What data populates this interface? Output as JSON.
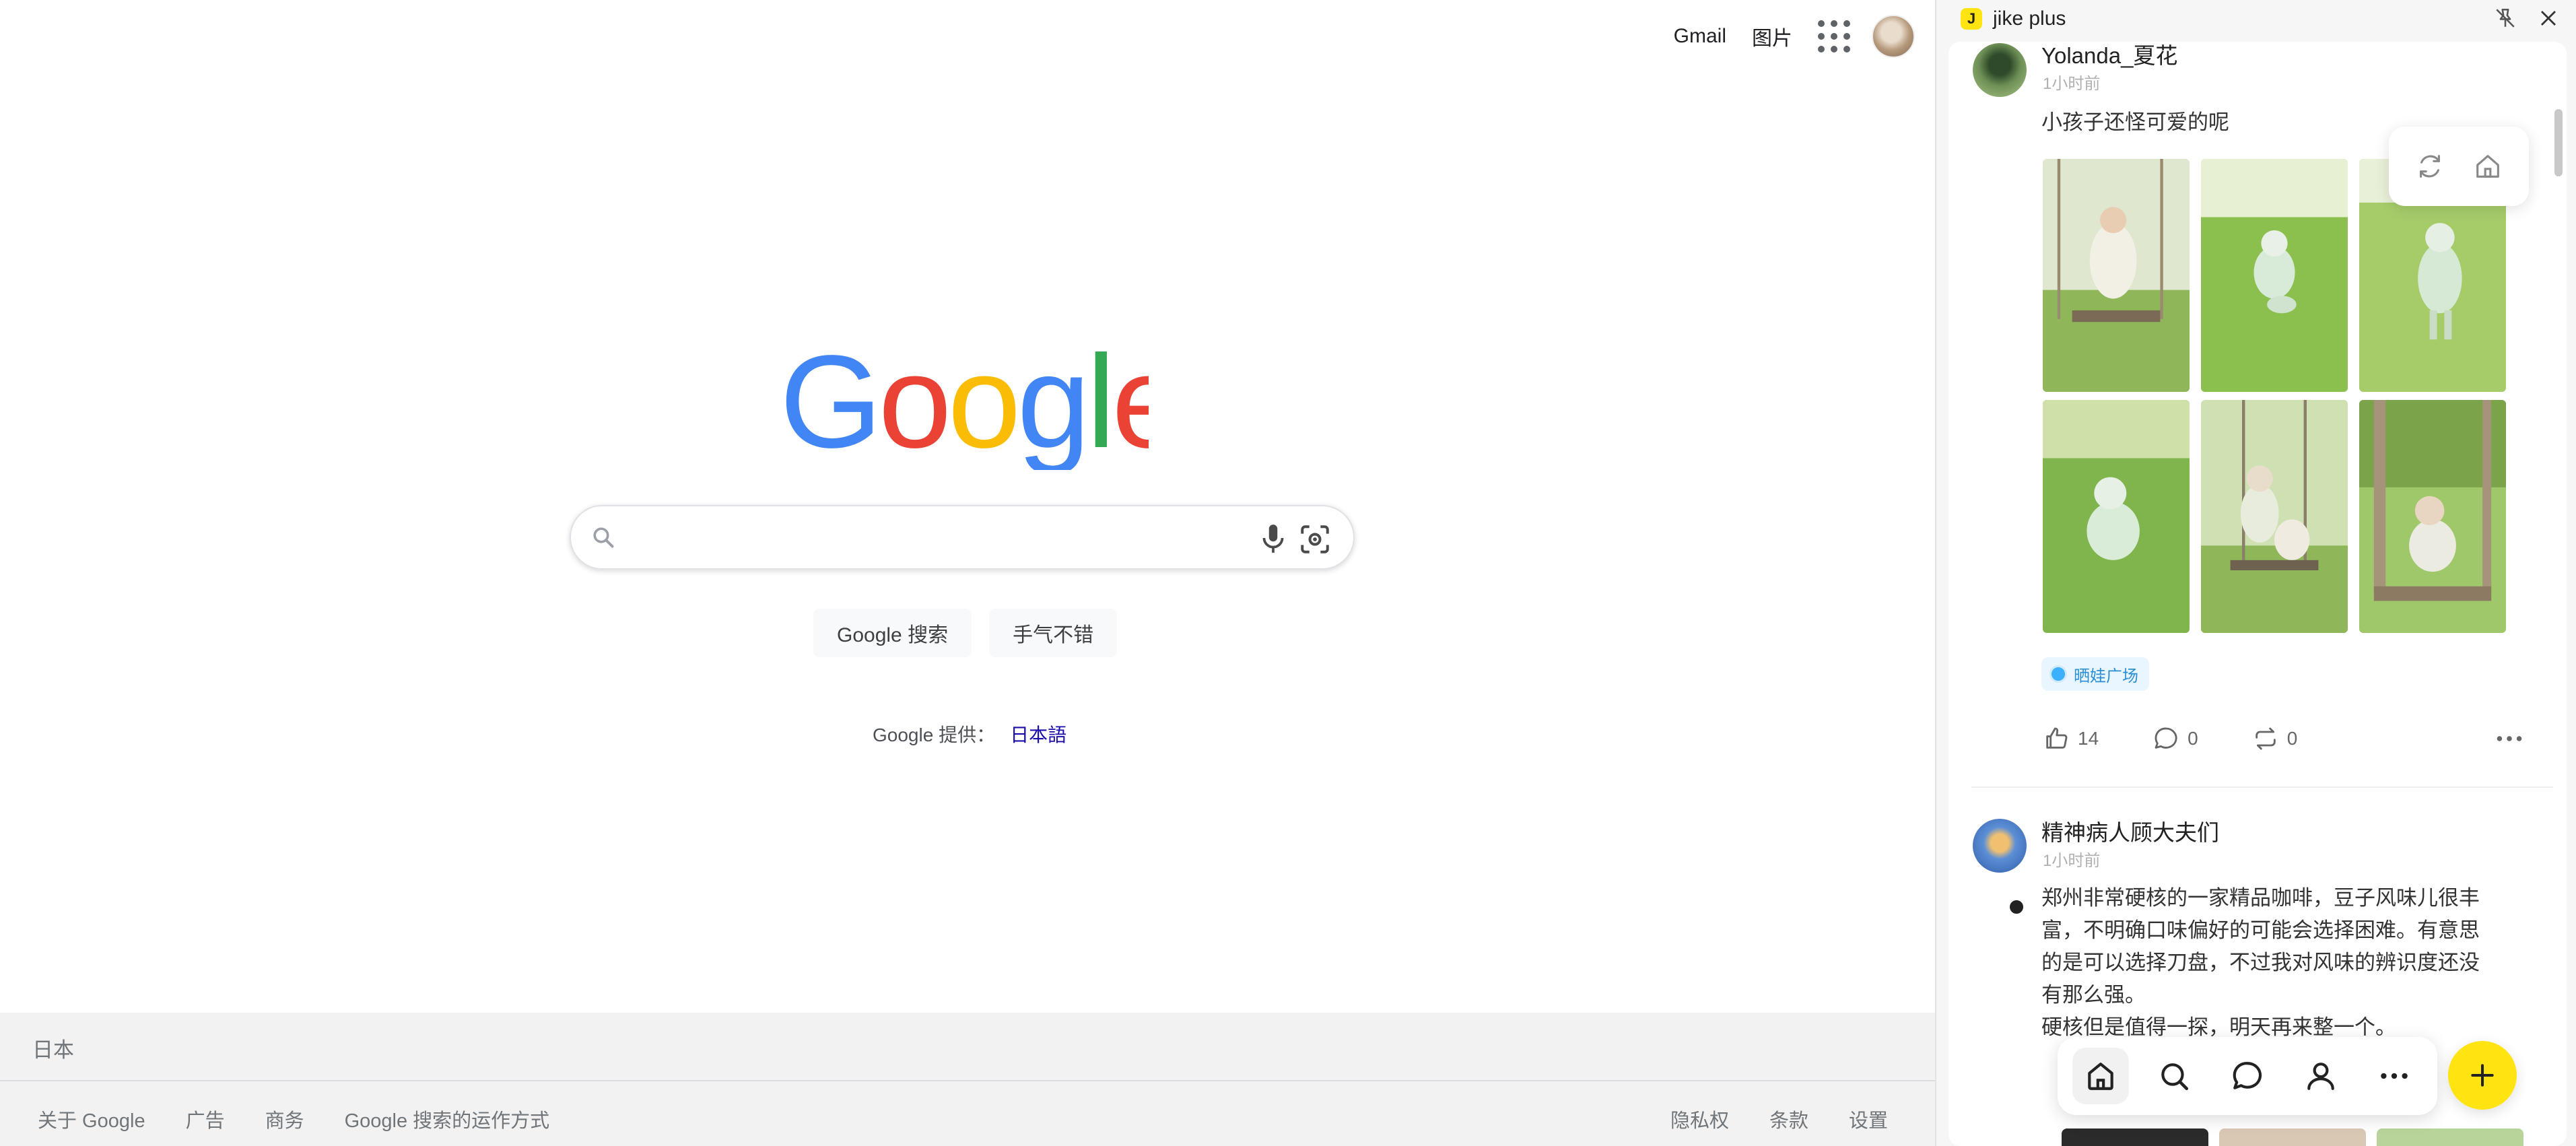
{
  "google": {
    "top_links": {
      "gmail": "Gmail",
      "images": "图片"
    },
    "search": {
      "placeholder": "",
      "value": ""
    },
    "buttons": {
      "search": "Google 搜索",
      "lucky": "手气不错"
    },
    "offered_in": {
      "label": "Google 提供：",
      "language": "日本語"
    },
    "footer": {
      "country": "日本",
      "left_links": [
        "关于 Google",
        "广告",
        "商务",
        "Google 搜索的运作方式"
      ],
      "right_links": [
        "隐私权",
        "条款",
        "设置"
      ]
    },
    "colors": {
      "blue": "#4285F4",
      "red": "#EA4335",
      "yellow": "#FBBC05",
      "green": "#34A853"
    }
  },
  "jike": {
    "window_title": "jike plus",
    "logo_glyph": "J",
    "accent": "#FFE411",
    "posts": [
      {
        "author": "Yolanda_夏花",
        "time": "1小时前",
        "text": "小孩子还怪可爱的呢",
        "photos_count": 6,
        "topic": "晒娃广场",
        "likes": "14",
        "comments": "0",
        "reposts": "0"
      },
      {
        "author": "精神病人顾大夫们",
        "time": "1小时前",
        "text_lines": [
          "郑州非常硬核的一家精品咖啡，豆子风味儿很丰",
          "富，不明确口味偏好的可能会选择困难。有意思",
          "的是可以选择刀盘，不过我对风味的辨识度还没",
          "有那么强。",
          "硬核但是值得一探，明天再来整一个。"
        ]
      }
    ],
    "float_tools": [
      "refresh-icon",
      "home-icon"
    ],
    "tabbar": [
      "home-icon",
      "search-icon",
      "message-icon",
      "profile-icon",
      "more-icon"
    ],
    "fab": "plus-icon"
  }
}
